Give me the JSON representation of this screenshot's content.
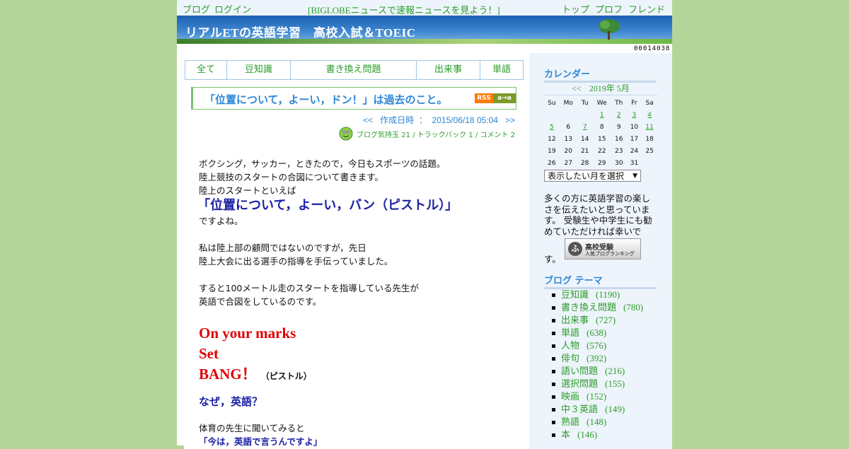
{
  "topbar": {
    "blog": "ブログ",
    "login": "ログイン",
    "news": "[BIGLOBEニュースで速報ニュースを見よう！]",
    "top": "トップ",
    "profile": "プロフ",
    "friend": "フレンド"
  },
  "banner": {
    "title": "リアルETの英語学習　高校入試＆TOEIC"
  },
  "counter": "00014038",
  "categories": [
    "全て",
    "豆知識",
    "書き換え問題",
    "出来事",
    "単語"
  ],
  "post": {
    "title": "「位置について，よーい，ドン！」は過去のこと。",
    "rss_a": "RSS",
    "rss_b": "a→a",
    "date_prev": "<<",
    "date_label": "作成日時",
    "date_sep": "：",
    "date": "2015/06/18 05:04",
    "date_next": ">>",
    "meta": "ブログ気持玉 21 / トラックバック 1 / コメント 2",
    "p1": "ボクシング，サッカー，ときたので，今日もスポーツの話題。",
    "p2": "陸上競技のスタートの合図について書きます。",
    "p3": "陸上のスタートといえば",
    "big": "「位置について，よーい，バン（ピストル）」",
    "p4": "ですよね。",
    "p5": "私は陸上部の顧問ではないのですが，先日",
    "p6": "陸上大会に出る選手の指導を手伝っていました。",
    "p7": "すると100メートル走のスタートを指導している先生が",
    "p8": "英語で合図をしているのです。",
    "red1": "On your marks",
    "red2": "Set",
    "red3": "BANG！",
    "pistol": "（ピストル）",
    "question": "なぜ，英語？",
    "p9": "体育の先生に聞いてみると",
    "quote": "「今は，英語で言うんですよ」"
  },
  "sidebar": {
    "calendar_heading": "カレンダー",
    "cal_prev": "<<",
    "cal_month": "2019年 5月",
    "weekdays": [
      "Su",
      "Mo",
      "Tu",
      "We",
      "Th",
      "Fr",
      "Sa"
    ],
    "weeks": [
      [
        "",
        "",
        "",
        "1",
        "2",
        "3",
        "4"
      ],
      [
        "5",
        "6",
        "7",
        "8",
        "9",
        "10",
        "11"
      ],
      [
        "12",
        "13",
        "14",
        "15",
        "16",
        "17",
        "18"
      ],
      [
        "19",
        "20",
        "21",
        "22",
        "23",
        "24",
        "25"
      ],
      [
        "26",
        "27",
        "28",
        "29",
        "30",
        "31",
        ""
      ]
    ],
    "linked_days": [
      "1",
      "2",
      "3",
      "4",
      "5",
      "7",
      "11"
    ],
    "month_select": "表示したい月を選択",
    "description": "多くの方に英語学習の楽しさを伝えたいと思っています。 受験生や中学生にも勧めていただければ幸いで",
    "description_end": "す。",
    "rank_icon": "ふ",
    "rank_title": "高校受験",
    "rank_sub": "人気ブログランキング",
    "themes_heading": "ブログ テーマ",
    "themes": [
      {
        "name": "豆知識",
        "count": "(1190)"
      },
      {
        "name": "書き換え問題",
        "count": "(780)"
      },
      {
        "name": "出来事",
        "count": "(727)"
      },
      {
        "name": "単語",
        "count": "(638)"
      },
      {
        "name": "人物",
        "count": "(576)"
      },
      {
        "name": "俳句",
        "count": "(392)"
      },
      {
        "name": "語い問題",
        "count": "(216)"
      },
      {
        "name": "選択問題",
        "count": "(155)"
      },
      {
        "name": "映画",
        "count": "(152)"
      },
      {
        "name": "中３英語",
        "count": "(149)"
      },
      {
        "name": "熟語",
        "count": "(148)"
      },
      {
        "name": "本",
        "count": "(146)"
      }
    ]
  }
}
